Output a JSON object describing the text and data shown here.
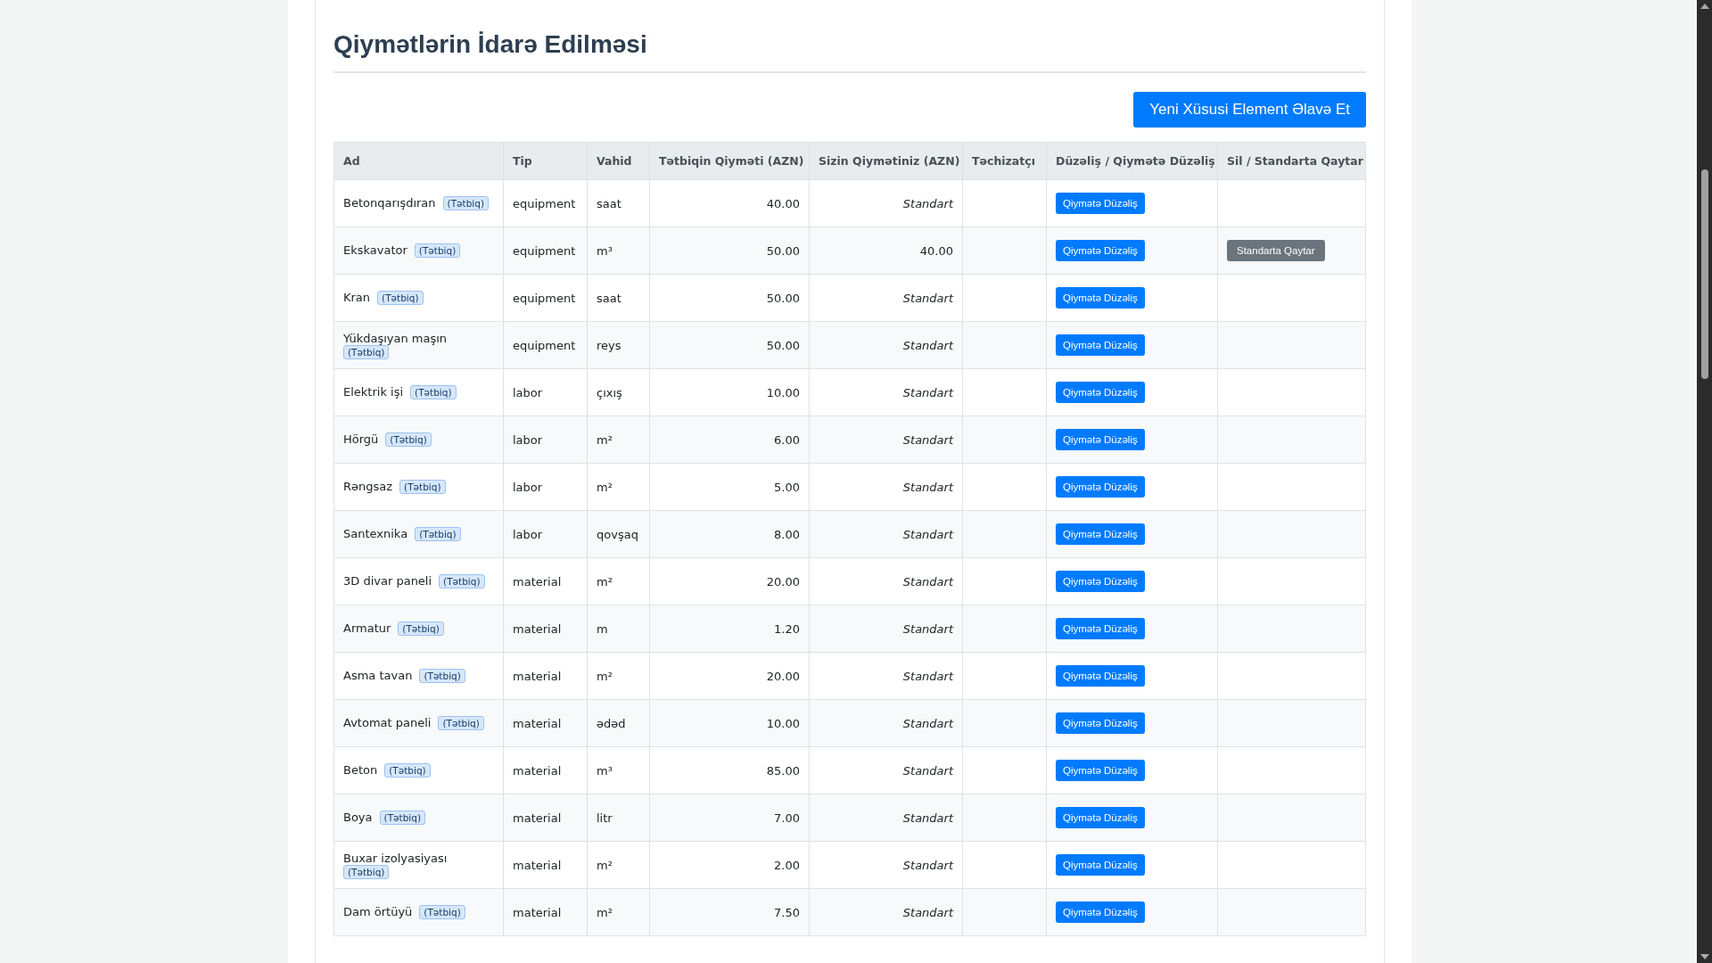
{
  "title": "Qiymətlərin İdarə Edilməsi",
  "add_button": "Yeni Xüsusi Element Əlavə Et",
  "table": {
    "columns": [
      "Ad",
      "Tip",
      "Vahid",
      "Tətbiqin Qiyməti (AZN)",
      "Sizin Qiymətiniz (AZN)",
      "Təchizatçı",
      "Düzəliş / Qiymətə Düzəliş",
      "Sil / Standarta Qaytar"
    ],
    "rows": [
      {
        "name": "Betonqarışdıran",
        "badge": "(Tətbiq)",
        "type": "equipment",
        "unit": "saat",
        "app_price": "40.00",
        "your_price": "Standart",
        "custom": false,
        "edit": "Qiymətə Düzəliş"
      },
      {
        "name": "Ekskavator",
        "badge": "(Tətbiq)",
        "type": "equipment",
        "unit": "m³",
        "app_price": "50.00",
        "your_price": "40.00",
        "custom": true,
        "edit": "Qiymətə Düzəliş",
        "reset": "Standarta Qaytar"
      },
      {
        "name": "Kran",
        "badge": "(Tətbiq)",
        "type": "equipment",
        "unit": "saat",
        "app_price": "50.00",
        "your_price": "Standart",
        "custom": false,
        "edit": "Qiymətə Düzəliş"
      },
      {
        "name": "Yükdaşıyan maşın",
        "badge": "(Tətbiq)",
        "type": "equipment",
        "unit": "reys",
        "app_price": "50.00",
        "your_price": "Standart",
        "custom": false,
        "edit": "Qiymətə Düzəliş"
      },
      {
        "name": "Elektrik işi",
        "badge": "(Tətbiq)",
        "type": "labor",
        "unit": "çıxış",
        "app_price": "10.00",
        "your_price": "Standart",
        "custom": false,
        "edit": "Qiymətə Düzəliş"
      },
      {
        "name": "Hörgü",
        "badge": "(Tətbiq)",
        "type": "labor",
        "unit": "m²",
        "app_price": "6.00",
        "your_price": "Standart",
        "custom": false,
        "edit": "Qiymətə Düzəliş"
      },
      {
        "name": "Rəngsaz",
        "badge": "(Tətbiq)",
        "type": "labor",
        "unit": "m²",
        "app_price": "5.00",
        "your_price": "Standart",
        "custom": false,
        "edit": "Qiymətə Düzəliş"
      },
      {
        "name": "Santexnika",
        "badge": "(Tətbiq)",
        "type": "labor",
        "unit": "qovşaq",
        "app_price": "8.00",
        "your_price": "Standart",
        "custom": false,
        "edit": "Qiymətə Düzəliş"
      },
      {
        "name": "3D divar paneli",
        "badge": "(Tətbiq)",
        "type": "material",
        "unit": "m²",
        "app_price": "20.00",
        "your_price": "Standart",
        "custom": false,
        "edit": "Qiymətə Düzəliş"
      },
      {
        "name": "Armatur",
        "badge": "(Tətbiq)",
        "type": "material",
        "unit": "m",
        "app_price": "1.20",
        "your_price": "Standart",
        "custom": false,
        "edit": "Qiymətə Düzəliş"
      },
      {
        "name": "Asma tavan",
        "badge": "(Tətbiq)",
        "type": "material",
        "unit": "m²",
        "app_price": "20.00",
        "your_price": "Standart",
        "custom": false,
        "edit": "Qiymətə Düzəliş"
      },
      {
        "name": "Avtomat paneli",
        "badge": "(Tətbiq)",
        "type": "material",
        "unit": "ədəd",
        "app_price": "10.00",
        "your_price": "Standart",
        "custom": false,
        "edit": "Qiymətə Düzəliş"
      },
      {
        "name": "Beton",
        "badge": "(Tətbiq)",
        "type": "material",
        "unit": "m³",
        "app_price": "85.00",
        "your_price": "Standart",
        "custom": false,
        "edit": "Qiymətə Düzəliş"
      },
      {
        "name": "Boya",
        "badge": "(Tətbiq)",
        "type": "material",
        "unit": "litr",
        "app_price": "7.00",
        "your_price": "Standart",
        "custom": false,
        "edit": "Qiymətə Düzəliş"
      },
      {
        "name": "Buxar izolyasiyası",
        "badge": "(Tətbiq)",
        "type": "material",
        "unit": "m²",
        "app_price": "2.00",
        "your_price": "Standart",
        "custom": false,
        "edit": "Qiymətə Düzəliş"
      },
      {
        "name": "Dam örtüyü",
        "badge": "(Tətbiq)",
        "type": "material",
        "unit": "m²",
        "app_price": "7.50",
        "your_price": "Standart",
        "custom": false,
        "edit": "Qiymətə Düzəliş"
      }
    ]
  }
}
